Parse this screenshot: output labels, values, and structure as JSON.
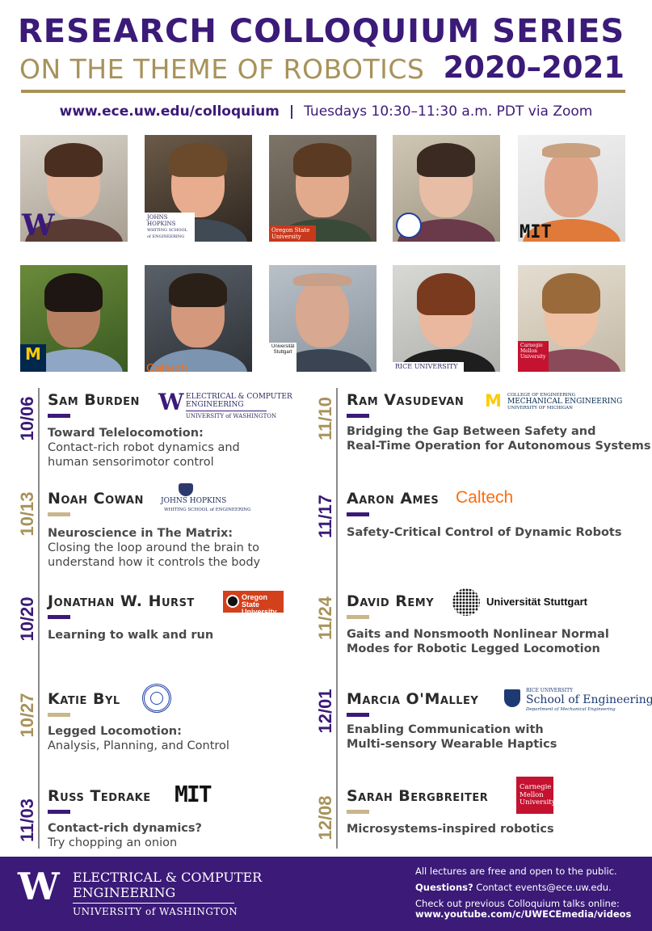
{
  "header": {
    "title_line1": "RESEARCH COLLOQUIUM SERIES",
    "title_line2": "ON THE THEME OF ROBOTICS",
    "year": "2020–2021",
    "url": "www.ece.uw.edu/colloquium",
    "separator": "|",
    "schedule": "Tuesdays 10:30–11:30 a.m. PDT via Zoom"
  },
  "photo_badges": {
    "uw": "W",
    "jhu": "JOHNS HOPKINS",
    "jhu_sub": "WHITING SCHOOL of ENGINEERING",
    "osu": "Oregon State University",
    "mit": "MIT",
    "umich": "M",
    "umich_sub": "UNIVERSITY OF MICHIGAN",
    "caltech": "Caltech",
    "stuttgart": "Universität Stuttgart",
    "rice": "RICE UNIVERSITY",
    "cmu": "Carnegie Mellon University"
  },
  "colors": {
    "uw_purple": "#3b1a78",
    "uw_gold": "#a8925a",
    "caltech_orange": "#ff6c0c",
    "osu_orange": "#d3401c",
    "cmu_red": "#c41230"
  },
  "talks_left": [
    {
      "date": "10/06",
      "speaker": "Sam Burden",
      "title1": "Toward Telelocomotion:",
      "title2": "Contact-rich robot dynamics and",
      "title3": "human sensorimotor control"
    },
    {
      "date": "10/13",
      "speaker": "Noah Cowan",
      "title1": "Neuroscience in The Matrix:",
      "title2": "Closing the loop around the brain to",
      "title3": "understand how it controls the body"
    },
    {
      "date": "10/20",
      "speaker": "Jonathan W. Hurst",
      "title1": "Learning to walk and run"
    },
    {
      "date": "10/27",
      "speaker": "Katie Byl",
      "title1": "Legged Locomotion:",
      "title2": "Analysis, Planning, and Control"
    },
    {
      "date": "11/03",
      "speaker": "Russ Tedrake",
      "title1": "Contact-rich dynamics?",
      "title2": "Try chopping an onion"
    }
  ],
  "talks_right": [
    {
      "date": "11/10",
      "speaker": "Ram Vasudevan",
      "title1": "Bridging the Gap Between Safety and",
      "title2": "Real-Time Operation for Autonomous Systems"
    },
    {
      "date": "11/17",
      "speaker": "Aaron Ames",
      "title1": "Safety-Critical Control of Dynamic Robots"
    },
    {
      "date": "11/24",
      "speaker": "David Remy",
      "title1": "Gaits and Nonsmooth Nonlinear Normal",
      "title2": "Modes for Robotic Legged Locomotion"
    },
    {
      "date": "12/01",
      "speaker": "Marcia O'Malley",
      "title1": "Enabling Communication with",
      "title2": "Multi-sensory Wearable Haptics"
    },
    {
      "date": "12/08",
      "speaker": "Sarah Bergbreiter",
      "title1": "Microsystems-inspired robotics"
    }
  ],
  "logos": {
    "uw_w": "W",
    "uw_ece1": "ELECTRICAL & COMPUTER",
    "uw_ece2": "ENGINEERING",
    "uw_name": "UNIVERSITY of WASHINGTON",
    "jhu1": "JOHNS HOPKINS",
    "jhu2": "WHITING SCHOOL of ENGINEERING",
    "osu": "Oregon State University",
    "mit": "MIT",
    "um_m": "M",
    "um1": "COLLEGE OF ENGINEERING",
    "um2": "MECHANICAL ENGINEERING",
    "um3": "UNIVERSITY OF MICHIGAN",
    "caltech": "Caltech",
    "stuttgart": "Universität Stuttgart",
    "rice1": "RICE UNIVERSITY",
    "rice2": "School of Engineering",
    "rice3": "Department of Mechanical Engineering",
    "cmu": "Carnegie Mellon University"
  },
  "footer": {
    "w": "W",
    "dept1": "ELECTRICAL & COMPUTER",
    "dept2": "ENGINEERING",
    "univ": "UNIVERSITY of WASHINGTON",
    "free": "All lectures are free and open to the public.",
    "questions_label": "Questions?",
    "questions_text": " Contact events@ece.uw.edu.",
    "previous": "Check out previous Colloquium talks online:",
    "youtube": "www.youtube.com/c/UWECEmedia/videos"
  }
}
